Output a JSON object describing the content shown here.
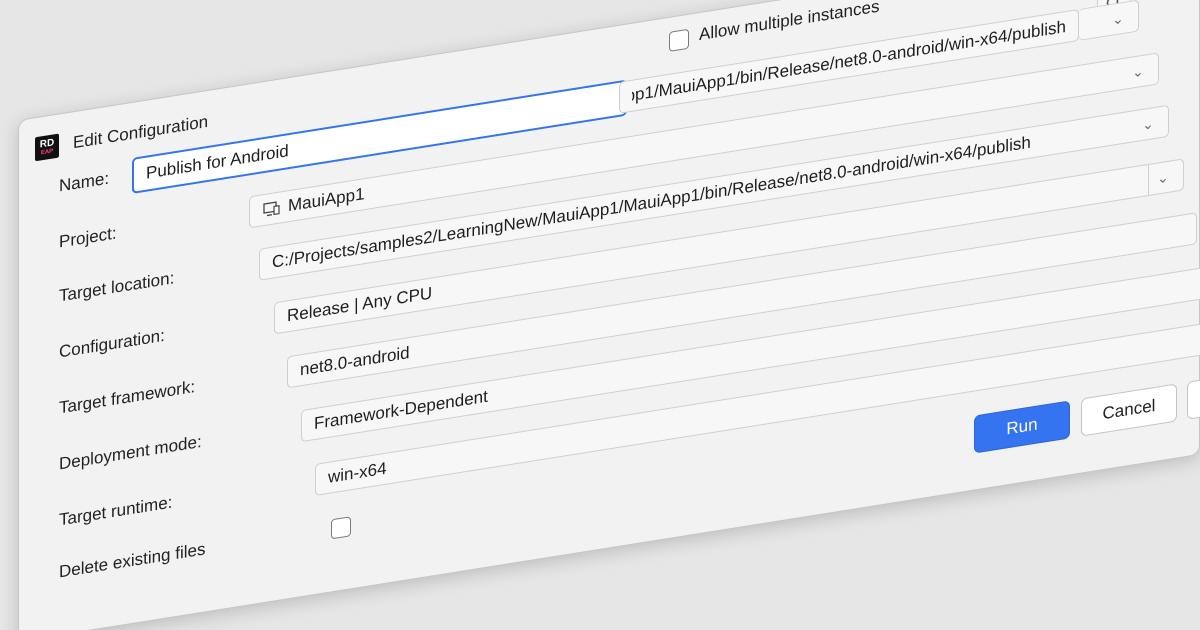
{
  "window": {
    "title": "Edit Configuration",
    "app_icon_text": "RD",
    "app_icon_badge": "EAP"
  },
  "form": {
    "name_label": "Name:",
    "name_value": "Publish for Android",
    "allow_multiple_label": "Allow multiple instances",
    "project_label": "Project:",
    "project_value": "MauiApp1",
    "target_location_label": "Target location:",
    "target_location_value": "C:/Projects/samples2/LearningNew/MauiApp1/MauiApp1/bin/Release/net8.0-android/win-x64/publish",
    "configuration_label": "Configuration:",
    "configuration_value": "Release | Any CPU",
    "target_framework_label": "Target framework:",
    "target_framework_value": "net8.0-android",
    "deployment_mode_label": "Deployment mode:",
    "deployment_mode_value": "Framework-Dependent",
    "target_runtime_label": "Target runtime:",
    "target_runtime_value": "win-x64",
    "delete_existing_label": "Delete existing files"
  },
  "buttons": {
    "run": "Run",
    "cancel": "Cancel"
  },
  "colors": {
    "accent": "#3574f0",
    "background": "#f2f2f2"
  },
  "icons": [
    "chevron-down-icon",
    "search-icon",
    "project-icon",
    "app-logo-icon"
  ]
}
